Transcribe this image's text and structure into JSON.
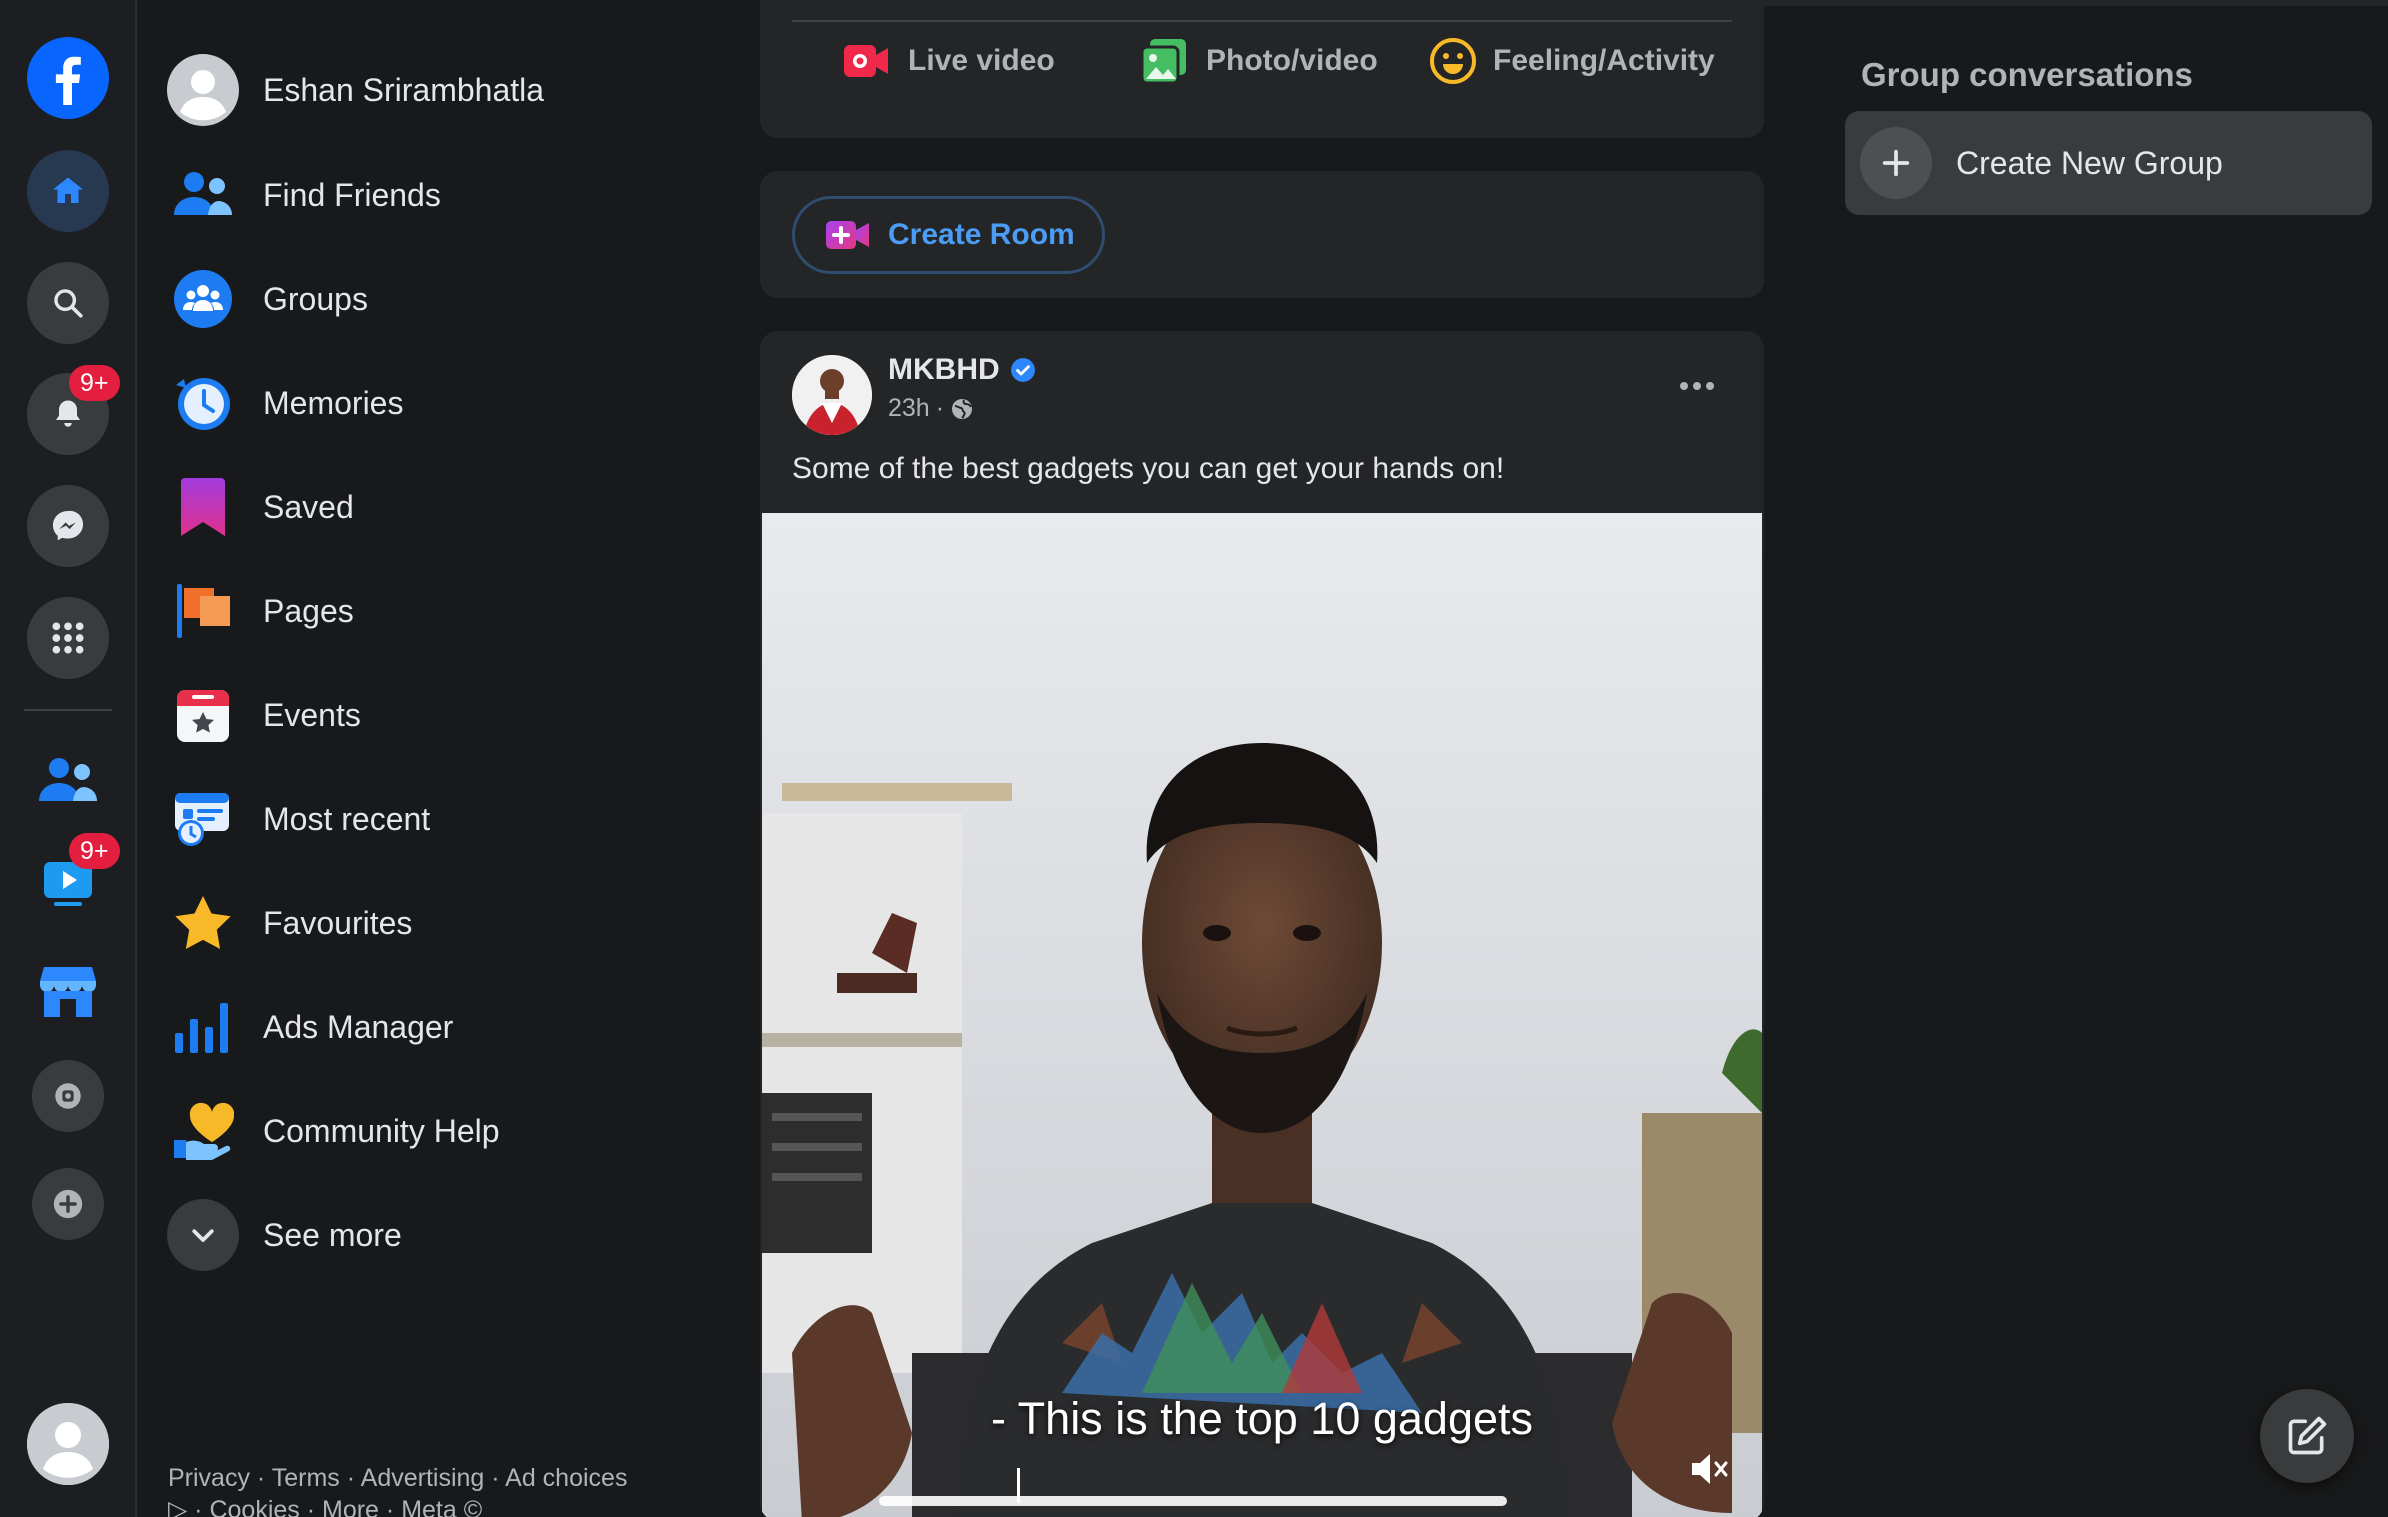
{
  "rail": {
    "items": [
      {
        "icon": "facebook-logo-icon"
      },
      {
        "icon": "home-icon"
      },
      {
        "icon": "search-icon"
      },
      {
        "icon": "notifications-bell-icon",
        "badge": "9+"
      },
      {
        "icon": "messenger-icon"
      },
      {
        "icon": "menu-grid-icon"
      },
      {
        "icon": "friends-icon"
      },
      {
        "icon": "watch-video-icon",
        "badge": "9+"
      },
      {
        "icon": "marketplace-icon"
      },
      {
        "icon": "gaming-icon"
      },
      {
        "icon": "add-icon"
      },
      {
        "icon": "profile-avatar-icon"
      }
    ]
  },
  "menu": {
    "profile_name": "Eshan Srirambhatla",
    "items": [
      {
        "label": "Find Friends"
      },
      {
        "label": "Groups"
      },
      {
        "label": "Memories"
      },
      {
        "label": "Saved"
      },
      {
        "label": "Pages"
      },
      {
        "label": "Events"
      },
      {
        "label": "Most recent"
      },
      {
        "label": "Favourites"
      },
      {
        "label": "Ads Manager"
      },
      {
        "label": "Community Help"
      }
    ],
    "see_more": "See more",
    "footer": {
      "privacy": "Privacy",
      "terms": "Terms",
      "advertising": "Advertising",
      "ad_choices": "Ad choices",
      "cookies": "Cookies",
      "more": "More",
      "meta": "Meta ©"
    }
  },
  "composer": {
    "live_video": "Live video",
    "photo_video": "Photo/video",
    "feeling": "Feeling/Activity"
  },
  "room": {
    "create_room": "Create Room"
  },
  "post": {
    "author": "MKBHD",
    "time": "23h",
    "text": "Some of the best gadgets you can get your hands on!",
    "video_caption": "- This is the top 10 gadgets"
  },
  "right": {
    "title": "Group conversations",
    "create_group": "Create New Group"
  },
  "colors": {
    "accent": "#2d88ff",
    "background": "#18191a",
    "card": "#242526",
    "badge": "#e41e3f"
  }
}
